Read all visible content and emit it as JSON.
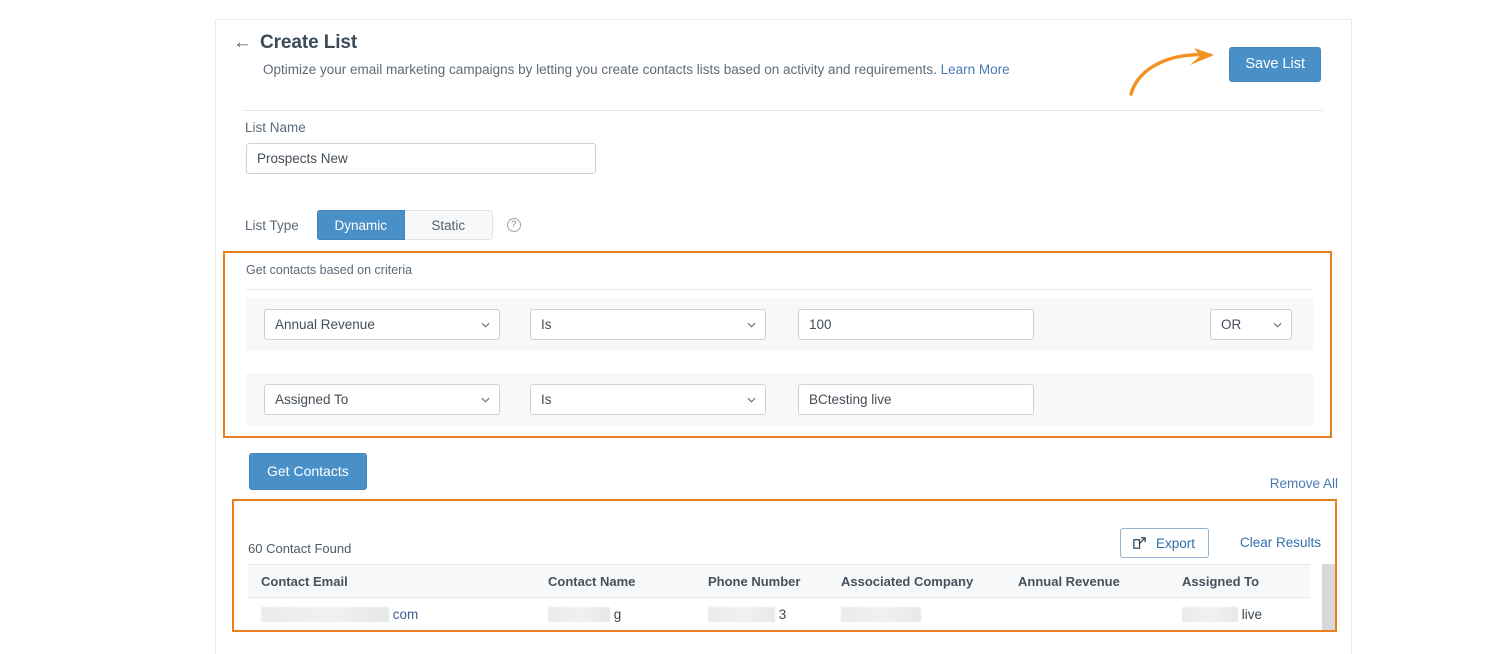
{
  "header": {
    "back_icon": "left-arrow-icon",
    "title": "Create List",
    "subtitle": "Optimize your email marketing campaigns by letting you create contacts lists based on activity and requirements.",
    "learn_more": "Learn More",
    "save_label": "Save List"
  },
  "list_name": {
    "label": "List Name",
    "value": "Prospects New",
    "placeholder": "Enter list name"
  },
  "list_type": {
    "label": "List Type",
    "options": [
      "Dynamic",
      "Static"
    ],
    "selected": "Dynamic",
    "help_icon": "question-mark-icon"
  },
  "criteria": {
    "title": "Get contacts based on criteria",
    "rows": [
      {
        "field": "Annual Revenue",
        "operator": "Is",
        "value": "100",
        "value_placeholder": "Enter value",
        "conjunction": "OR"
      },
      {
        "field": "Assigned To",
        "operator": "Is",
        "value": "BCtesting live",
        "value_placeholder": "Enter value",
        "conjunction": ""
      }
    ],
    "get_contacts_label": "Get Contacts",
    "remove_all_label": "Remove All"
  },
  "results": {
    "count_label": "60 Contact Found",
    "export_label": "Export",
    "export_icon": "external-link-icon",
    "clear_label": "Clear Results",
    "columns": [
      "Contact Email",
      "Contact Name",
      "Phone Number",
      "Associated Company",
      "Annual Revenue",
      "Assigned To"
    ],
    "rows": [
      {
        "contact_email": "com",
        "contact_email_redacted": true,
        "contact_name": "g",
        "contact_name_redacted": true,
        "phone_number": "3",
        "phone_number_redacted": true,
        "associated_company": "",
        "associated_company_redacted": true,
        "annual_revenue": "",
        "annual_revenue_redacted": false,
        "assigned_to": "live",
        "assigned_to_redacted": true
      }
    ]
  },
  "annotations": {
    "arrow_color": "#f29222",
    "arrow_target": "save-list-button"
  },
  "colors": {
    "accent_blue": "#4a90c8",
    "link_blue": "#4a79b5",
    "highlight_orange": "#e8811d",
    "text_dark": "#3c4a57",
    "text_muted": "#5d6b78",
    "panel_grey": "#f7f8f9"
  }
}
